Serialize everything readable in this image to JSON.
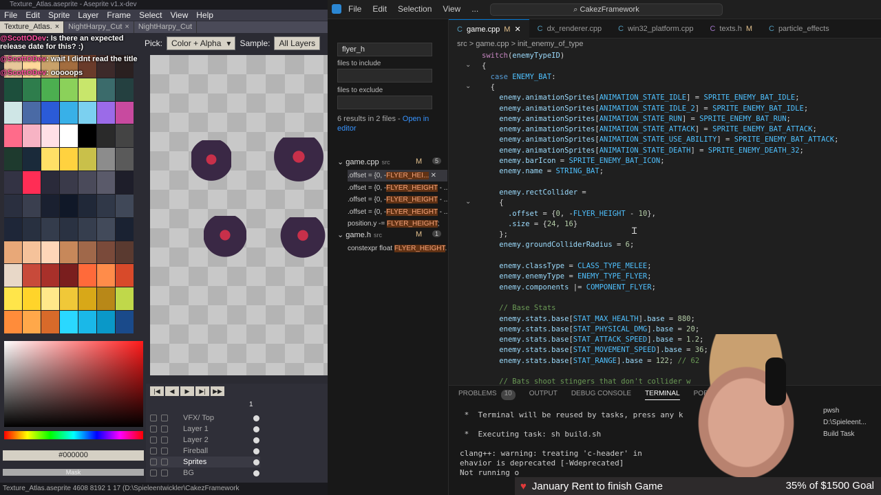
{
  "aseprite": {
    "title": "Texture_Atlas.aseprite - Aseprite v1.x-dev",
    "menu": [
      "File",
      "Edit",
      "Sprite",
      "Layer",
      "Frame",
      "Select",
      "View",
      "Help"
    ],
    "tabs": [
      {
        "label": "Texture_Atlas.",
        "close": "×",
        "active": true
      },
      {
        "label": "NightHarpy_Cut",
        "close": "×",
        "active": false
      },
      {
        "label": "NightHarpy_Cut",
        "close": "",
        "active": false
      }
    ],
    "context": {
      "pick_label": "Pick:",
      "pick_value": "Color + Alpha",
      "sample_label": "Sample:",
      "sample_value": "All Layers"
    },
    "chat": [
      {
        "user": "@ScottODev",
        "text": ": Is there an expected release date for this? :)"
      },
      {
        "user": "@ScottODev",
        "text": ": wait I didnt read the title"
      },
      {
        "user": "@ScottODev",
        "text": ": ooooops"
      }
    ],
    "palette": [
      "#e8c79a",
      "#ffd89a",
      "#c9a26a",
      "#a36d3f",
      "#6a3b2a",
      "#3d2a2a",
      "#2a2020",
      "#1d4f3c",
      "#2e7d4c",
      "#4caf50",
      "#8bd15a",
      "#c8e66b",
      "#3b6b6b",
      "#244040",
      "#cfe6e6",
      "#4a6aa5",
      "#2b5bd7",
      "#38b0e8",
      "#7bd0f0",
      "#9b6be8",
      "#c84a9f",
      "#ff6b8a",
      "#f7b3c4",
      "#ffe0e6",
      "#ffffff",
      "#000000",
      "#2a2a2a",
      "#444444",
      "#1e3a2e",
      "#1a2a3a",
      "#ffe066",
      "#ffd23f",
      "#c9c04a",
      "#8c8c8c",
      "#5a5a5a",
      "#333344",
      "#ff2d55",
      "#2a2a3a",
      "#3a3a4a",
      "#4a4a5a",
      "#5a5a6a",
      "#1e1e2a",
      "#2a2f3f",
      "#3a3f4f",
      "#1a2030",
      "#101828",
      "#202838",
      "#303848",
      "#404858",
      "#1e2638",
      "#283040",
      "#343c4c",
      "#2a3242",
      "#363e4e",
      "#424a5a",
      "#1a2232",
      "#e8a878",
      "#f5c29a",
      "#ffd6b8",
      "#c7885a",
      "#a0684a",
      "#7a4a3a",
      "#5a3a30",
      "#e8d8c8",
      "#c84a3a",
      "#a8302a",
      "#7a1e1e",
      "#ff6a3a",
      "#ff8c4a",
      "#d84a2a",
      "#ffe54a",
      "#ffd42a",
      "#ffe88a",
      "#f0c838",
      "#d8a818",
      "#b88818",
      "#c0d84a",
      "#ff8c3a",
      "#ffa84a",
      "#d86a2a",
      "#2ad8ff",
      "#1ab8e8",
      "#0a98c8",
      "#1a4a8a"
    ],
    "hex": "#000000",
    "mask": "Mask",
    "frame": "1",
    "layers": [
      {
        "name": "VFX/ Top",
        "active": false
      },
      {
        "name": "Layer 1",
        "active": false
      },
      {
        "name": "Layer 2",
        "active": false
      },
      {
        "name": "Fireball",
        "active": false
      },
      {
        "name": "Sprites",
        "active": true
      },
      {
        "name": "BG",
        "active": false
      }
    ],
    "status": "Texture_Atlas.aseprite   4608 8192   1 17   (D:\\Spieleentwickler\\CakezFramework"
  },
  "vscode": {
    "menu": [
      "File",
      "Edit",
      "Selection",
      "View",
      "..."
    ],
    "search_title": "CakezFramework",
    "search": {
      "query": "flyer_h",
      "files_include": "files to include",
      "files_exclude": "files to exclude",
      "results_summary": "6 results in 2 files - ",
      "open_in_editor": "Open in editor",
      "files": [
        {
          "name": "game.cpp",
          "folder": "src",
          "mod": "M",
          "count": "5",
          "matches": [
            {
              "pre": ".offset = {0, -",
              "hl": "FLYER_HEI...",
              "post": "",
              "active": true
            },
            {
              "pre": ".offset = {0, -",
              "hl": "FLYER_HEIGHT",
              "post": " - ...",
              "active": false
            },
            {
              "pre": ".offset = {0, -",
              "hl": "FLYER_HEIGHT",
              "post": " - ...",
              "active": false
            },
            {
              "pre": ".offset = {0, -",
              "hl": "FLYER_HEIGHT",
              "post": " - ...",
              "active": false
            },
            {
              "pre": "position.y -= ",
              "hl": "FLYER_HEIGHT",
              "post": ";",
              "active": false
            }
          ]
        },
        {
          "name": "game.h",
          "folder": "src",
          "mod": "M",
          "count": "1",
          "matches": [
            {
              "pre": "constexpr float ",
              "hl": "FLYER_HEIGHT",
              "post": "...",
              "active": false
            }
          ]
        }
      ]
    },
    "tabs": [
      {
        "label": "game.cpp",
        "mod": "M",
        "active": true
      },
      {
        "label": "dx_renderer.cpp",
        "mod": "",
        "active": false
      },
      {
        "label": "win32_platform.cpp",
        "mod": "",
        "active": false
      },
      {
        "label": "texts.h",
        "mod": "M",
        "active": false
      },
      {
        "label": "particle_effects",
        "mod": "",
        "active": false
      }
    ],
    "breadcrumb": "src  >  game.cpp  >  init_enemy_of_type",
    "code_lines": [
      "switch(enemyTypeID)",
      "{",
      "  case ENEMY_BAT:",
      "  {",
      "    enemy.animationSprites[ANIMATION_STATE_IDLE] = SPRITE_ENEMY_BAT_IDLE;",
      "    enemy.animationSprites[ANIMATION_STATE_IDLE_2] = SPRITE_ENEMY_BAT_IDLE;",
      "    enemy.animationSprites[ANIMATION_STATE_RUN] = SPRITE_ENEMY_BAT_RUN;",
      "    enemy.animationSprites[ANIMATION_STATE_ATTACK] = SPRITE_ENEMY_BAT_ATTACK;",
      "    enemy.animationSprites[ANIMATION_STATE_USE_ABILITY] = SPRITE_ENEMY_BAT_ATTACK;",
      "    enemy.animationSprites[ANIMATION_STATE_DEATH] = SPRITE_ENEMY_DEATH_32;",
      "    enemy.barIcon = SPRITE_ENEMY_BAT_ICON;",
      "    enemy.name = STRING_BAT;",
      "",
      "    enemy.rectCollider =",
      "    {",
      "      .offset = {0, -FLYER_HEIGHT - 10},",
      "      .size = {24, 16}",
      "    };",
      "    enemy.groundColliderRadius = 6;",
      "",
      "    enemy.classType = CLASS_TYPE_MELEE;",
      "    enemy.enemyType = ENEMY_TYPE_FLYER;",
      "    enemy.components |= COMPONENT_FLYER;",
      "",
      "    // Base Stats",
      "    enemy.stats.base[STAT_MAX_HEALTH].base = 880;",
      "    enemy.stats.base[STAT_PHYSICAL_DMG].base = 20;",
      "    enemy.stats.base[STAT_ATTACK_SPEED].base = 1.2;",
      "    enemy.stats.base[STAT_MOVEMENT_SPEED].base = 36;",
      "    enemy.stats.base[STAT_RANGE].base = 122; // 62",
      "",
      "    // Bats shoot stingers that don't collider w"
    ],
    "panel": {
      "tabs": [
        "PROBLEMS",
        "10",
        "OUTPUT",
        "DEBUG CONSOLE",
        "TERMINAL",
        "PORTS"
      ],
      "terminal_lines": [
        " *  Terminal will be reused by tasks, press any k",
        "",
        " *  Executing task: sh build.sh",
        "",
        "clang++: warning: treating 'c-header' in",
        "ehavior is deprecated [-Wdeprecated]",
        "Not running o"
      ],
      "terminal_list": [
        "pwsh",
        "D:\\Spieleent...",
        "Build  Task"
      ]
    }
  },
  "overlay": {
    "goal_text": "January Rent to finish Game",
    "goal_progress": "35% of $1500 Goal",
    "heart_icon": "heart-icon"
  }
}
